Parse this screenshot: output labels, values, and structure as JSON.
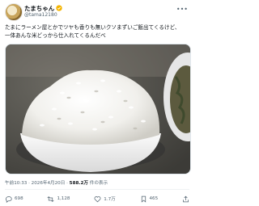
{
  "post": {
    "author_name": "たまちゃん",
    "handle": "@tama12180",
    "text_lines": [
      "たまにラーメン屋とかでツヤも香りも無いクソまずいご飯出てくるけど、",
      "一体あんな米どっから仕入れてくるんだべ"
    ],
    "timestamp": "午前10:33 · 2026年4月20日 · ",
    "views_count": "588.2万",
    "views_label": " 件の表示"
  },
  "actions": {
    "replies": "698",
    "reposts": "1,128",
    "likes": "1.7万",
    "bookmarks": "465"
  },
  "icons": {
    "verified": "verified-badge-icon",
    "more": "more-options-icon",
    "reply": "reply-icon",
    "repost": "repost-icon",
    "like": "heart-icon",
    "bookmark": "bookmark-icon"
  },
  "colors": {
    "verified": "#f4b400",
    "text": "#0f1419",
    "muted": "#536471"
  }
}
